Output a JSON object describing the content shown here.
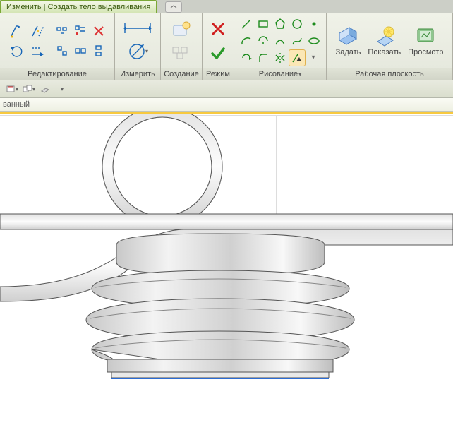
{
  "tab": {
    "label": "Изменить | Создать тело выдавливания"
  },
  "panels": {
    "edit": "Редактирование",
    "measure": "Измерить",
    "create": "Создание",
    "mode": "Режим",
    "draw": "Рисование",
    "workplane": "Рабочая плоскость"
  },
  "workplane": {
    "set": "Задать",
    "show": "Показать",
    "viewer": "Просмотр"
  },
  "breadcrumb": {
    "text": "ванный"
  },
  "icons": {
    "modify1": "modify1",
    "modify2": "modify2",
    "undo": "undo",
    "align": "align",
    "grid1": "grid1",
    "grid2": "grid2",
    "grid3": "grid3",
    "grid4": "grid4",
    "grid5": "grid5",
    "grid6": "grid6",
    "dim": "dim",
    "diam": "diam",
    "create1": "create1",
    "create2": "create2",
    "cancel": "cancel",
    "finish": "finish",
    "line": "line",
    "rect": "rect",
    "poly": "poly",
    "circ": "circ",
    "dot": "dot",
    "arc1": "arc1",
    "arc2": "arc2",
    "arc3": "arc3",
    "sp": "sp",
    "el": "el",
    "pick": "pick",
    "fill": "fill",
    "mir": "mir",
    "sel": "sel",
    "wpset": "wpset",
    "wpshow": "wpshow",
    "wpview": "wpview",
    "q1": "q1",
    "q2": "q2",
    "q3": "q3",
    "q4": "q4"
  }
}
